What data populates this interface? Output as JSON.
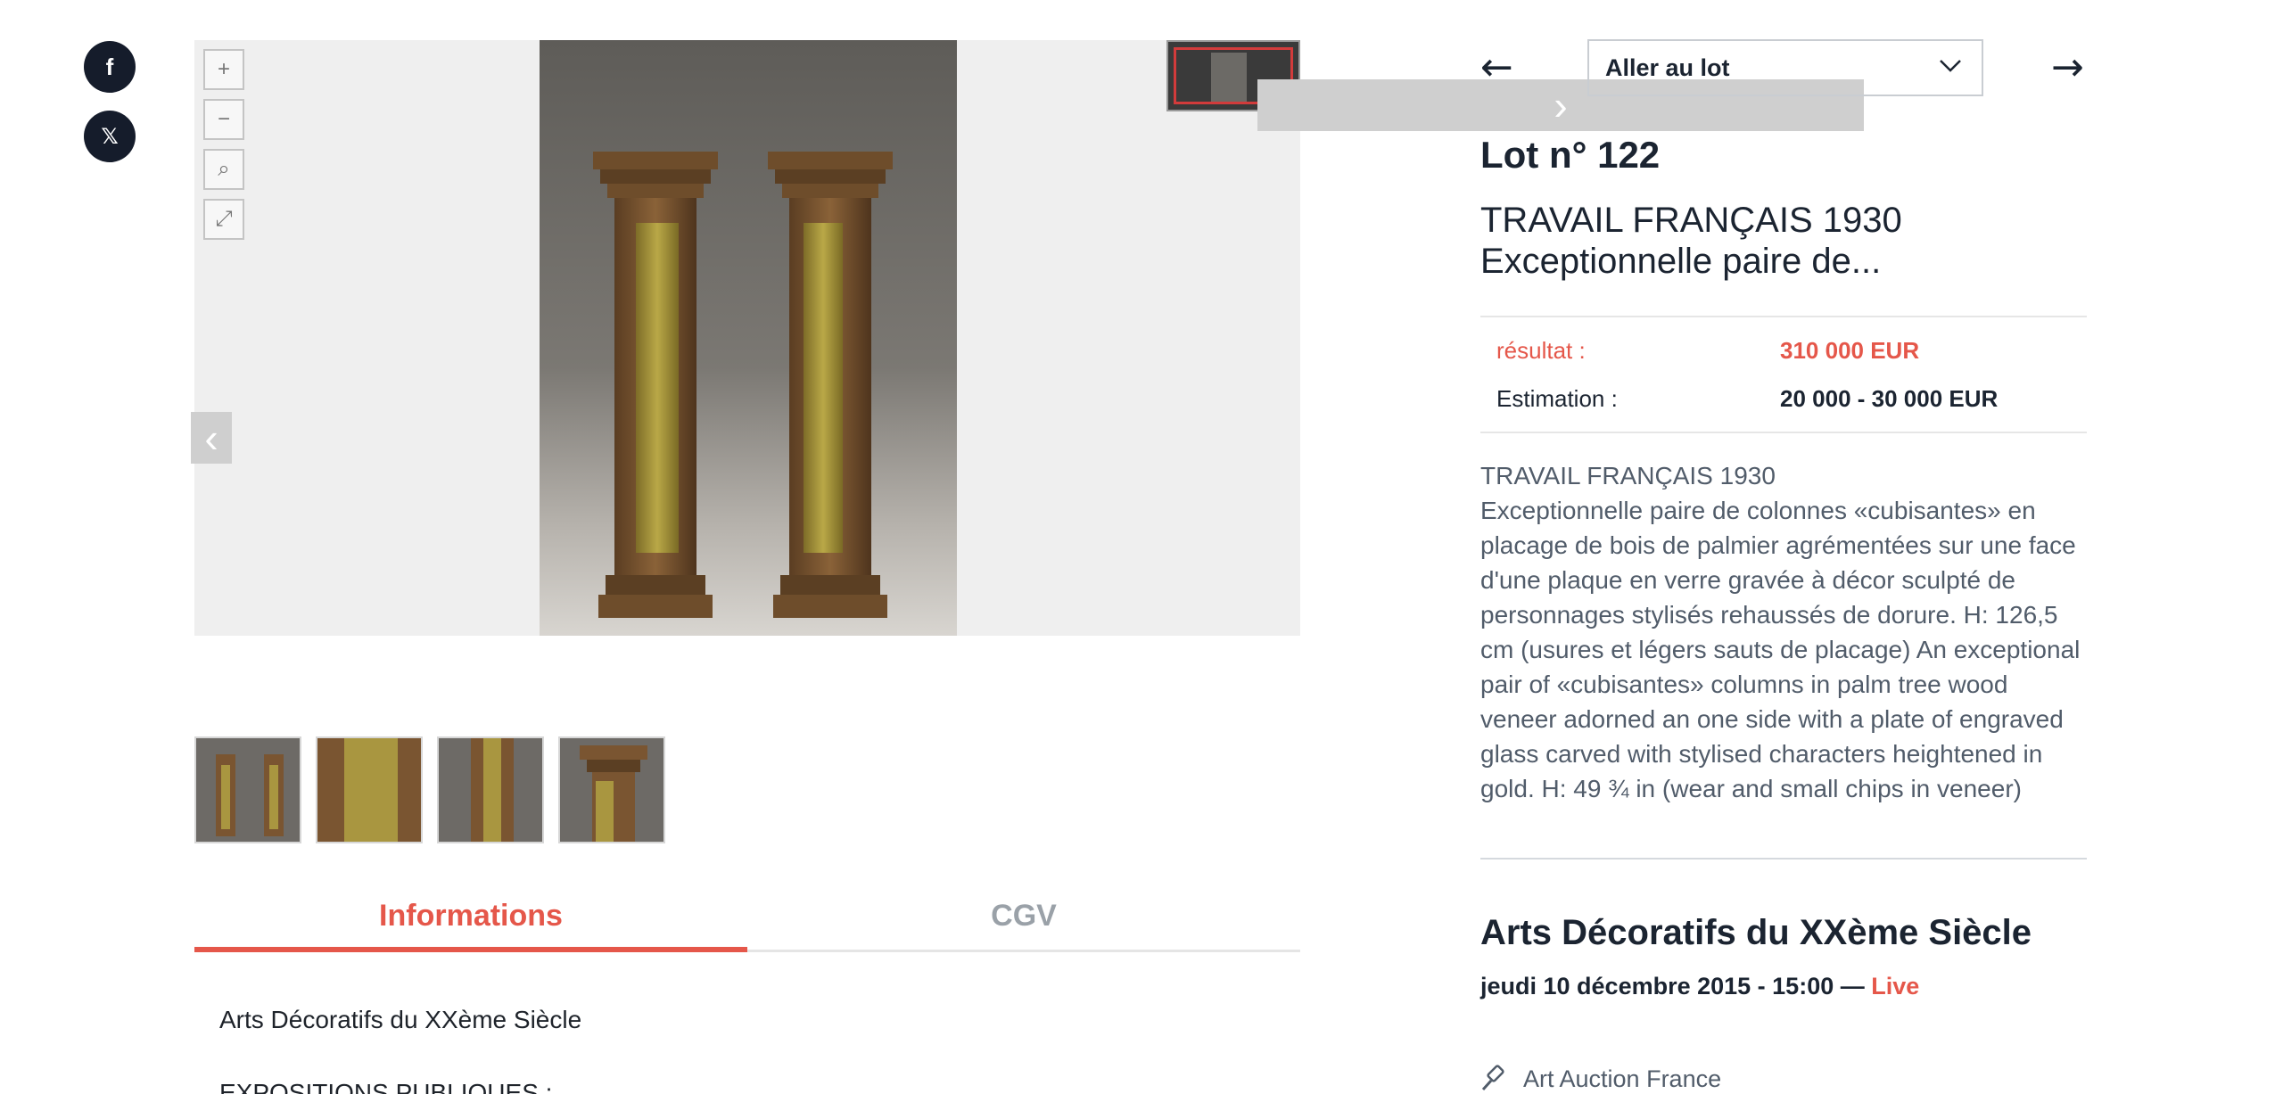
{
  "social": {
    "facebook_glyph": "f",
    "x_glyph": "𝕏"
  },
  "viewer": {
    "zoom_in": "+",
    "zoom_out": "−",
    "search_glyph": "⌕",
    "fullscreen_glyph": "⤢",
    "prev_glyph": "‹",
    "next_glyph": "›"
  },
  "tabs": {
    "informations": "Informations",
    "cgv": "CGV"
  },
  "info": {
    "line1": "Arts Décoratifs du XXème Siècle",
    "line2": "EXPOSITIONS PUBLIQUES :"
  },
  "lot_nav": {
    "prev_arrow": "←",
    "next_arrow": "→",
    "select_label": "Aller au lot"
  },
  "lot": {
    "number": "Lot n° 122",
    "title_line1": "TRAVAIL FRANÇAIS 1930",
    "title_line2": "Exceptionnelle paire de...",
    "result_label": "résultat :",
    "result_value": "310 000 EUR",
    "estimate_label": "Estimation :",
    "estimate_value": "20 000 - 30 000 EUR",
    "description": "TRAVAIL FRANÇAIS 1930\nExceptionnelle paire de colonnes «cubisantes» en placage de bois de palmier agrémentées sur une face d'une plaque en verre gravée à décor sculpté de personnages stylisés rehaussés de dorure. H: 126,5 cm (usures et légers sauts de placage) An exceptional pair of «cubisantes» columns in palm tree wood veneer adorned an one side with a plate of engraved glass carved with stylised characters heightened in gold. H: 49 ¾ in (wear and small chips in veneer)"
  },
  "sale": {
    "title": "Arts Décoratifs du XXème Siècle",
    "date": "jeudi 10 décembre 2015 - 15:00 — ",
    "live": "Live",
    "house": "Art Auction France"
  },
  "colors": {
    "accent": "#e5574a",
    "navy": "#1b2431",
    "text_muted": "#515c6a"
  }
}
